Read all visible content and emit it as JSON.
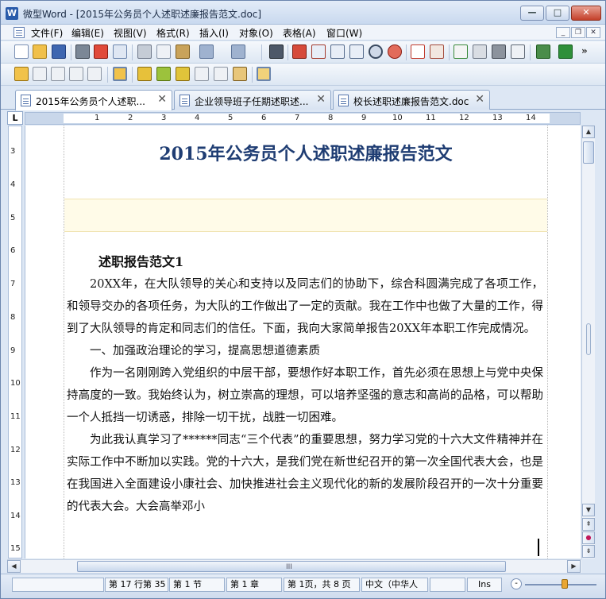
{
  "window": {
    "app_icon": "W",
    "title": "微型Word - [2015年公务员个人述职述廉报告范文.doc]",
    "controls": {
      "minimize": "—",
      "maximize": "□",
      "close": "✕"
    }
  },
  "menubar": {
    "items": [
      "文件(F)",
      "编辑(E)",
      "视图(V)",
      "格式(R)",
      "插入(I)",
      "对象(O)",
      "表格(A)",
      "窗口(W)"
    ],
    "mdi": {
      "minimize": "_",
      "restore": "❐",
      "close": "✕"
    }
  },
  "toolbar1": {
    "icons": [
      "new-icon",
      "open-icon",
      "save-icon",
      "print-icon",
      "pdf-icon",
      "print-preview-icon",
      "cut-icon",
      "copy-icon",
      "paste-icon",
      "undo-icon",
      "redo-icon",
      "find-icon",
      "insert-page-number-icon",
      "insert-field-icon",
      "page-layout-icon",
      "columns-icon",
      "zoom-icon",
      "zoom-percent-icon",
      "font-color-icon",
      "format-icon",
      "spellcheck-icon",
      "chart-icon",
      "shadow-icon",
      "frame-icon",
      "bookmark-icon",
      "show-marks-icon"
    ],
    "more": "»"
  },
  "toolbar2": {
    "icons": [
      "review-icon",
      "edit-note-icon",
      "delete-note-icon",
      "prev-note-icon",
      "next-note-icon",
      "compare-icon",
      "track-changes-icon",
      "accept-icon",
      "reject-icon",
      "accept-all-icon",
      "reject-all-icon",
      "reviewing-pane-icon",
      "protect-icon"
    ]
  },
  "tabs": [
    {
      "label": "2015年公务员个人述职...",
      "active": true
    },
    {
      "label": "企业领导班子任期述职述...",
      "active": false
    },
    {
      "label": "校长述职述廉报告范文.doc",
      "active": false
    }
  ],
  "tab_close": "✕",
  "ruler": {
    "corner": "L",
    "h_numbers": [
      "1",
      "2",
      "3",
      "4",
      "5",
      "6",
      "7",
      "8",
      "9",
      "10",
      "11",
      "12",
      "13",
      "14"
    ],
    "v_numbers": [
      "3",
      "4",
      "5",
      "6",
      "7",
      "8",
      "9",
      "10",
      "11",
      "12",
      "13",
      "14",
      "15"
    ]
  },
  "document": {
    "title": "2015年公务员个人述职述廉报告范文",
    "heading": "述职报告范文1",
    "paragraphs": [
      "20XX年，在大队领导的关心和支持以及同志们的协助下，综合科圆满完成了各项工作，和领导交办的各项任务，为大队的工作做出了一定的贡献。我在工作中也做了大量的工作，得到了大队领导的肯定和同志们的信任。下面，我向大家简单报告20XX年本职工作完成情况。",
      "一、加强政治理论的学习，提高思想道德素质",
      "作为一名刚刚跨入党组织的中层干部，要想作好本职工作，首先必须在思想上与党中央保持高度的一致。我始终认为，树立崇高的理想，可以培养坚强的意志和高尚的品格，可以帮助一个人抵挡一切诱惑，排除一切干扰，战胜一切困难。",
      "为此我认真学习了******同志“三个代表”的重要思想，努力学习党的十六大文件精神并在实际工作中不断加以实践。党的十六大，是我们党在新世纪召开的第一次全国代表大会，也是在我国进入全面建设小康社会、加快推进社会主义现代化的新的发展阶段召开的一次十分重要的代表大会。大会高举邓小"
    ]
  },
  "scrollbar": {
    "up": "▲",
    "down": "▼",
    "prev_page": "⇞",
    "browse": "●",
    "next_page": "⇟",
    "left": "◀",
    "right": "▶",
    "grip": "III"
  },
  "statusbar": {
    "position": "第 17 行第 35",
    "section": "第 1 节",
    "chapter": "第 1 章",
    "page": "第 1页，共 8 页",
    "language": "中文（中华人",
    "mode": "Ins",
    "zoom_minus": "-"
  }
}
